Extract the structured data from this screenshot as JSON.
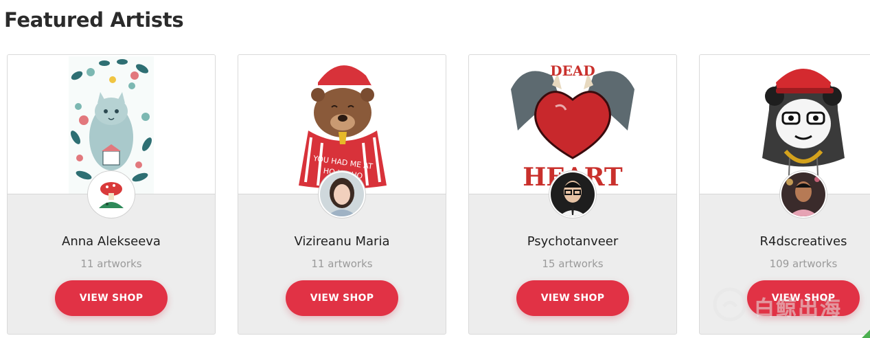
{
  "section": {
    "title": "Featured Artists"
  },
  "accent_color": "#e13245",
  "artists": [
    {
      "name": "Anna Alekseeva",
      "artworks": "11 artworks",
      "button": "VIEW SHOP",
      "art_icon": "floral-cat-illustration",
      "avatar_icon": "mushroom-avatar"
    },
    {
      "name": "Vizireanu Maria",
      "artworks": "11 artworks",
      "button": "VIEW SHOP",
      "art_icon": "christmas-bear-illustration",
      "avatar_icon": "portrait-avatar"
    },
    {
      "name": "Psychotanveer",
      "artworks": "15 artworks",
      "button": "VIEW SHOP",
      "art_icon": "dead-heart-illustration",
      "avatar_icon": "portrait-avatar"
    },
    {
      "name": "R4dscreatives",
      "artworks": "109 artworks",
      "button": "VIEW SHOP",
      "art_icon": "panda-headphones-illustration",
      "avatar_icon": "portrait-avatar"
    }
  ],
  "watermark": {
    "text": "白鲸出海"
  }
}
